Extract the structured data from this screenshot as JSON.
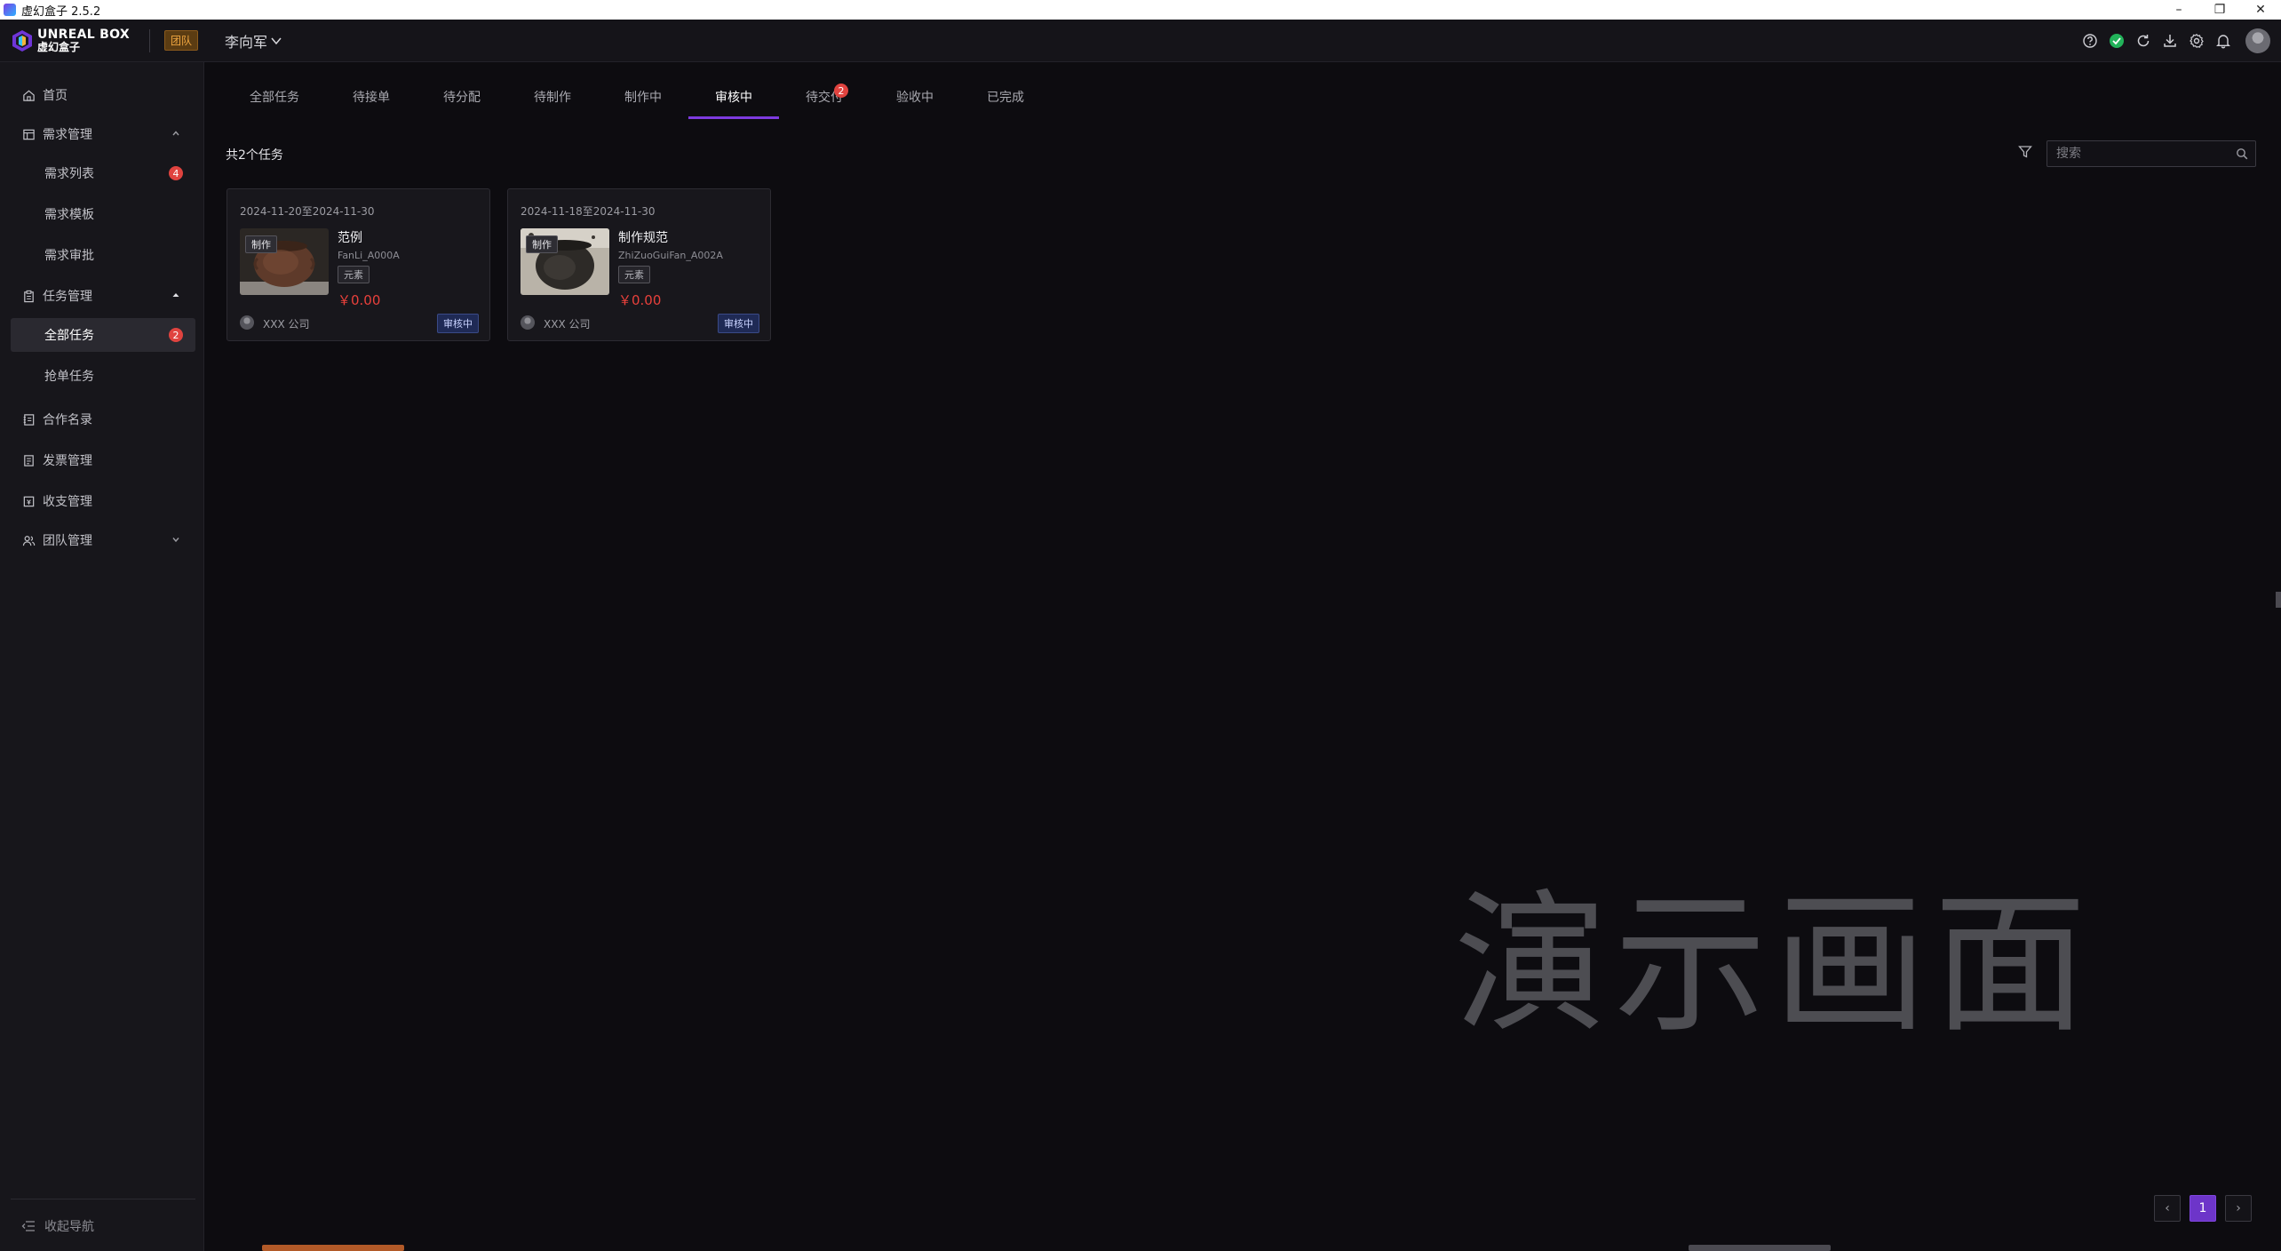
{
  "os": {
    "title": "虚幻盒子 2.5.2",
    "min": "–",
    "restore": "❐",
    "close": "✕"
  },
  "header": {
    "logo_en": "UNREAL BOX",
    "logo_cn": "虚幻盒子",
    "team_badge": "团队",
    "user_name": "李向军",
    "icons": [
      "help-icon",
      "check-circle-icon",
      "refresh-icon",
      "download-icon",
      "settings-icon",
      "bell-icon",
      "avatar"
    ]
  },
  "sidebar": {
    "home": "首页",
    "demand_mgmt": "需求管理",
    "demand_list": "需求列表",
    "demand_list_badge": "4",
    "demand_template": "需求模板",
    "demand_approval": "需求审批",
    "task_mgmt": "任务管理",
    "all_tasks": "全部任务",
    "all_tasks_badge": "2",
    "grab_tasks": "抢单任务",
    "partners": "合作名录",
    "invoice": "发票管理",
    "finance": "收支管理",
    "team": "团队管理",
    "collapse": "收起导航"
  },
  "tabs": [
    {
      "label": "全部任务"
    },
    {
      "label": "待接单"
    },
    {
      "label": "待分配"
    },
    {
      "label": "待制作"
    },
    {
      "label": "制作中"
    },
    {
      "label": "审核中"
    },
    {
      "label": "待交付",
      "badge": "2"
    },
    {
      "label": "验收中"
    },
    {
      "label": "已完成"
    }
  ],
  "main": {
    "count_text": "共2个任务",
    "search_placeholder": "搜索",
    "watermark": "演示画面"
  },
  "cards": [
    {
      "date": "2024-11-20至2024-11-30",
      "tag": "制作",
      "name": "范例",
      "code": "FanLi_A000A",
      "type": "元素",
      "price": "￥0.00",
      "company": "XXX 公司",
      "status": "审核中"
    },
    {
      "date": "2024-11-18至2024-11-30",
      "tag": "制作",
      "name": "制作规范",
      "code": "ZhiZuoGuiFan_A002A",
      "type": "元素",
      "price": "￥0.00",
      "company": "XXX 公司",
      "status": "审核中"
    }
  ],
  "pager": {
    "prev": "‹",
    "current": "1",
    "next": "›"
  },
  "colors": {
    "accent": "#7d3bdf",
    "badge": "#e0433f",
    "price": "#e8403b",
    "team_badge": "#f0a640"
  }
}
